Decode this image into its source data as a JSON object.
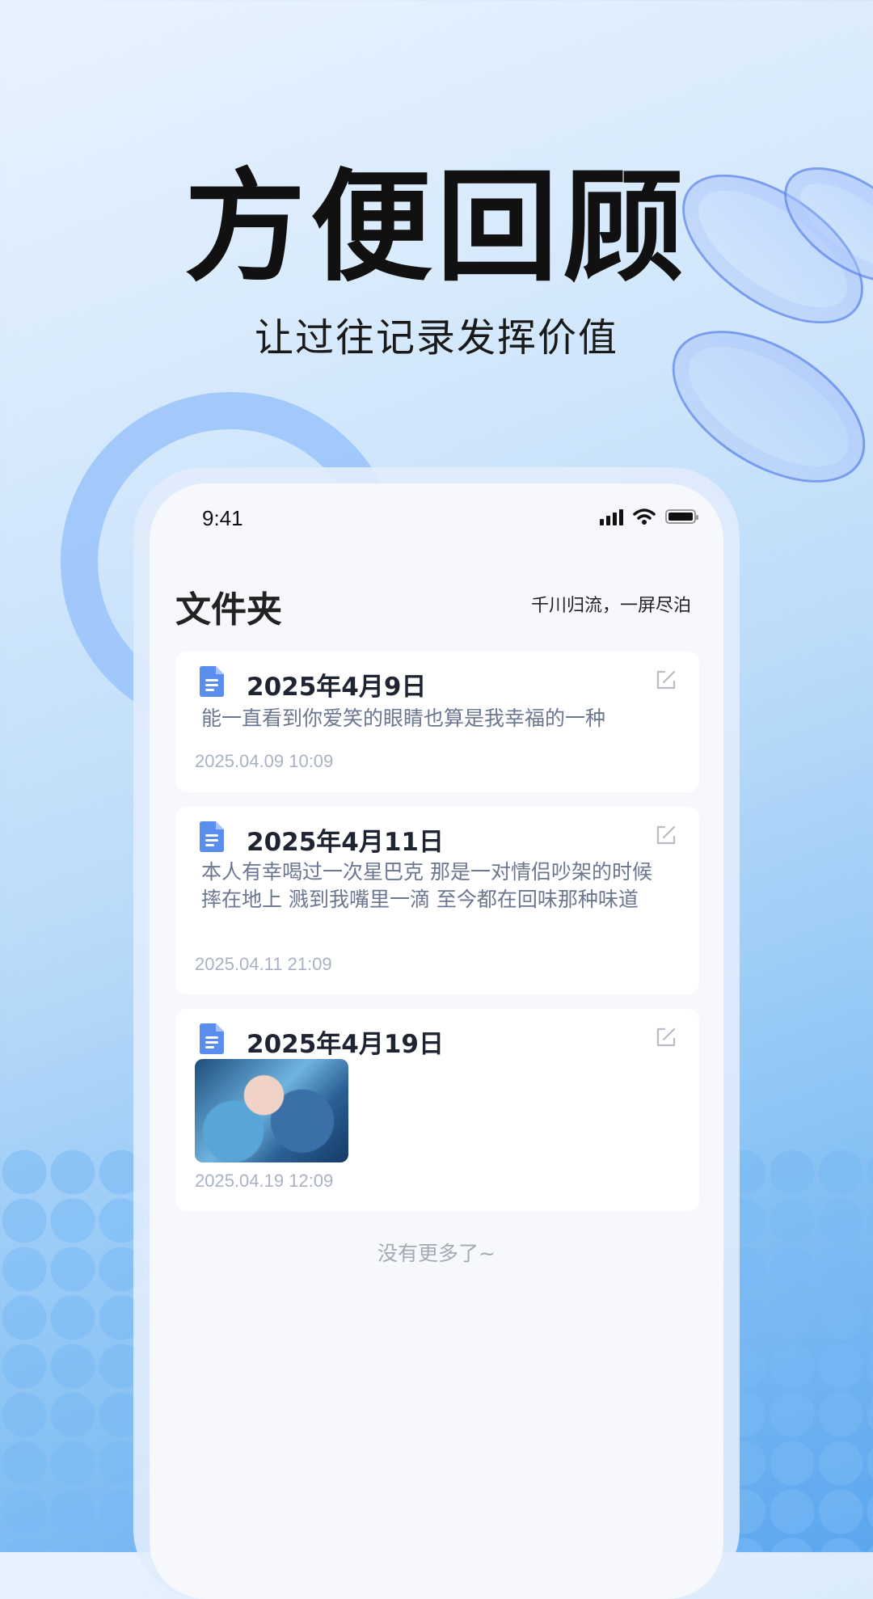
{
  "promo": {
    "headline": "方便回顾",
    "subline": "让过往记录发挥价值"
  },
  "status_bar": {
    "time": "9:41"
  },
  "header": {
    "title": "文件夹",
    "slogan": "千川归流，一屏尽泊"
  },
  "notes": [
    {
      "title": "2025年4月9日",
      "body": "能一直看到你爱笑的眼睛也算是我幸福的一种",
      "timestamp": "2025.04.09 10:09"
    },
    {
      "title": "2025年4月11日",
      "body": "本人有幸喝过一次星巴克 那是一对情侣吵架的时候摔在地上 溅到我嘴里一滴 至今都在回味那种味道",
      "timestamp": "2025.04.11 21:09"
    },
    {
      "title": "2025年4月19日",
      "image": "anime-illustration-thumbnail",
      "timestamp": "2025.04.19 12:09"
    }
  ],
  "footer": {
    "no_more": "没有更多了~"
  },
  "colors": {
    "accent": "#5b8def",
    "background_top": "#e9f3ff",
    "background_bottom": "#5aa6ee"
  }
}
